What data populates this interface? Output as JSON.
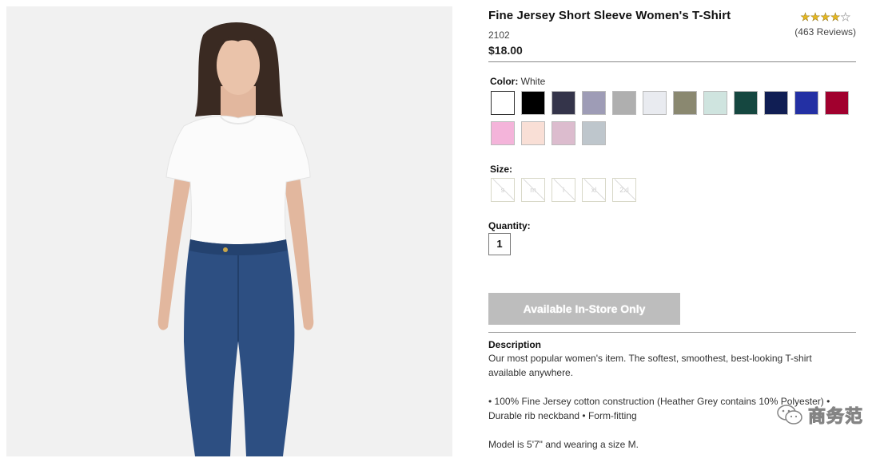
{
  "product": {
    "title": "Fine Jersey Short Sleeve Women's T-Shirt",
    "sku": "2102",
    "price": "$18.00",
    "rating": 4,
    "rating_max": 5,
    "reviews": "(463 Reviews)"
  },
  "color": {
    "label": "Color:",
    "selected": "White",
    "swatches": [
      {
        "name": "White",
        "hex": "#ffffff"
      },
      {
        "name": "Black",
        "hex": "#000000"
      },
      {
        "name": "Navy",
        "hex": "#34344a"
      },
      {
        "name": "Lavender Grey",
        "hex": "#9e9cb6"
      },
      {
        "name": "Light Grey",
        "hex": "#afafaf"
      },
      {
        "name": "Pale Grey",
        "hex": "#e9ebf0"
      },
      {
        "name": "Olive",
        "hex": "#8a8870"
      },
      {
        "name": "Mint",
        "hex": "#cfe4df"
      },
      {
        "name": "Forest",
        "hex": "#154740"
      },
      {
        "name": "Dark Navy",
        "hex": "#101e54"
      },
      {
        "name": "Royal",
        "hex": "#2330a4"
      },
      {
        "name": "Cranberry",
        "hex": "#a1002e"
      },
      {
        "name": "Pink",
        "hex": "#f4b4da"
      },
      {
        "name": "Peach",
        "hex": "#f9dfd6"
      },
      {
        "name": "Orchid",
        "hex": "#dcbcce"
      },
      {
        "name": "Blue Grey",
        "hex": "#bec6cc"
      }
    ]
  },
  "size": {
    "label": "Size:",
    "options": [
      "s",
      "m",
      "l",
      "xl",
      "2xl"
    ]
  },
  "quantity": {
    "label": "Quantity:",
    "value": "1"
  },
  "action": {
    "button_label": "Available In-Store Only"
  },
  "description": {
    "label": "Description",
    "paragraphs": [
      "Our most popular women's item. The softest, smoothest, best-looking T-shirt available anywhere.",
      "• 100% Fine Jersey cotton construction (Heather Grey contains 10% Polyester) • Durable rib neckband • Form-fitting",
      "Model is 5'7\" and wearing a size M."
    ]
  },
  "watermark": {
    "text": "商务范"
  }
}
